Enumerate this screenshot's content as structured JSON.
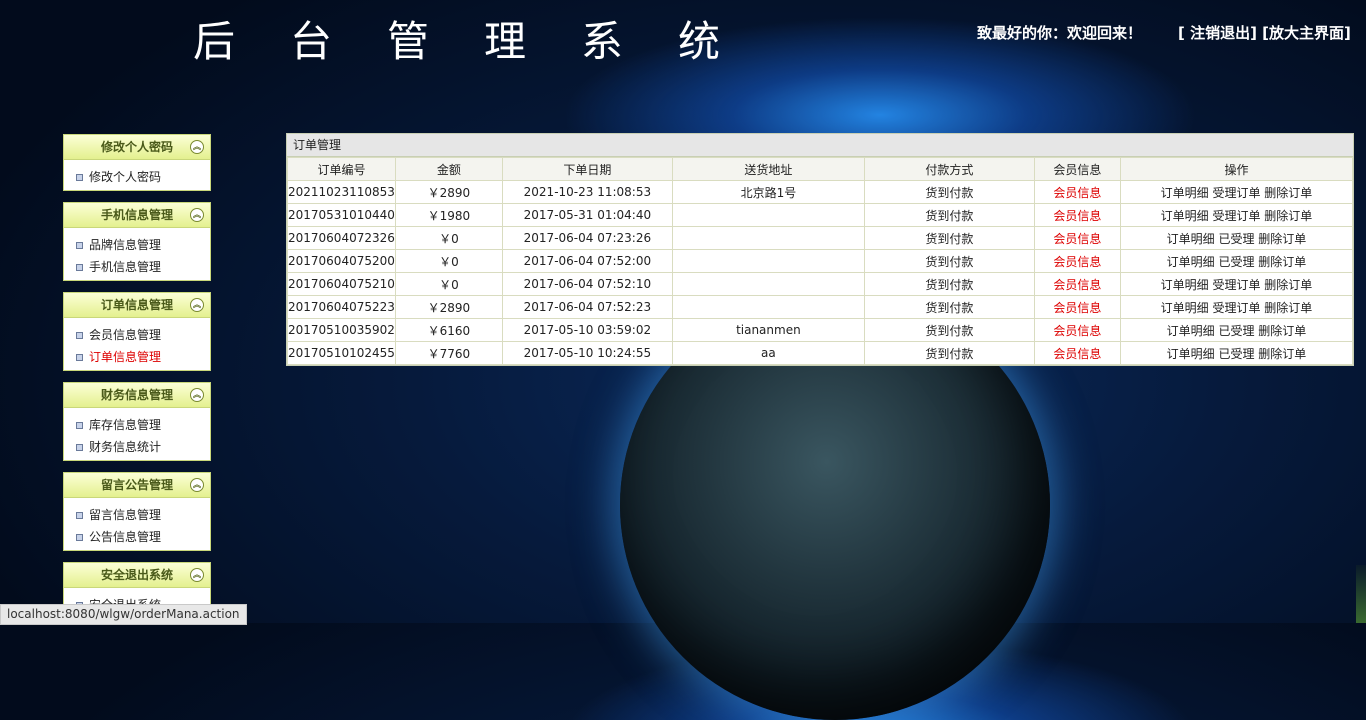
{
  "header": {
    "title_chars": [
      "后",
      "台",
      "管",
      "理",
      "系",
      "统"
    ],
    "welcome": "致最好的你：欢迎回来！",
    "logout": "[ 注销退出]",
    "zoom": "[放大主界面]"
  },
  "sidebar": {
    "menus": [
      {
        "title": "修改个人密码",
        "items": [
          "修改个人密码"
        ]
      },
      {
        "title": "手机信息管理",
        "items": [
          "品牌信息管理",
          "手机信息管理"
        ]
      },
      {
        "title": "订单信息管理",
        "items": [
          "会员信息管理",
          "订单信息管理"
        ]
      },
      {
        "title": "财务信息管理",
        "items": [
          "库存信息管理",
          "财务信息统计"
        ]
      },
      {
        "title": "留言公告管理",
        "items": [
          "留言信息管理",
          "公告信息管理"
        ]
      },
      {
        "title": "安全退出系统",
        "items": [
          "安全退出系统"
        ]
      }
    ]
  },
  "panel": {
    "title": "订单管理",
    "columns": [
      "订单编号",
      "金额",
      "下单日期",
      "送货地址",
      "付款方式",
      "会员信息",
      "操作"
    ],
    "rows": [
      {
        "id": "20211023110853",
        "amount": "￥2890",
        "date": "2021-10-23 11:08:53",
        "address": "北京路1号",
        "payment": "货到付款",
        "member": "会员信息",
        "op1": "订单明细",
        "op2": "受理订单",
        "op3": "删除订单"
      },
      {
        "id": "20170531010440",
        "amount": "￥1980",
        "date": "2017-05-31 01:04:40",
        "address": "",
        "payment": "货到付款",
        "member": "会员信息",
        "op1": "订单明细",
        "op2": "受理订单",
        "op3": "删除订单"
      },
      {
        "id": "20170604072326",
        "amount": "￥0",
        "date": "2017-06-04 07:23:26",
        "address": "",
        "payment": "货到付款",
        "member": "会员信息",
        "op1": "订单明细",
        "op2": "已受理",
        "op3": "删除订单"
      },
      {
        "id": "20170604075200",
        "amount": "￥0",
        "date": "2017-06-04 07:52:00",
        "address": "",
        "payment": "货到付款",
        "member": "会员信息",
        "op1": "订单明细",
        "op2": "已受理",
        "op3": "删除订单"
      },
      {
        "id": "20170604075210",
        "amount": "￥0",
        "date": "2017-06-04 07:52:10",
        "address": "",
        "payment": "货到付款",
        "member": "会员信息",
        "op1": "订单明细",
        "op2": "受理订单",
        "op3": "删除订单"
      },
      {
        "id": "20170604075223",
        "amount": "￥2890",
        "date": "2017-06-04 07:52:23",
        "address": "",
        "payment": "货到付款",
        "member": "会员信息",
        "op1": "订单明细",
        "op2": "受理订单",
        "op3": "删除订单"
      },
      {
        "id": "20170510035902",
        "amount": "￥6160",
        "date": "2017-05-10 03:59:02",
        "address": "tiananmen",
        "payment": "货到付款",
        "member": "会员信息",
        "op1": "订单明细",
        "op2": "已受理",
        "op3": "删除订单"
      },
      {
        "id": "20170510102455",
        "amount": "￥7760",
        "date": "2017-05-10 10:24:55",
        "address": "aa",
        "payment": "货到付款",
        "member": "会员信息",
        "op1": "订单明细",
        "op2": "已受理",
        "op3": "删除订单"
      }
    ]
  },
  "statusbar": {
    "url": "localhost:8080/wlgw/orderMana.action"
  }
}
